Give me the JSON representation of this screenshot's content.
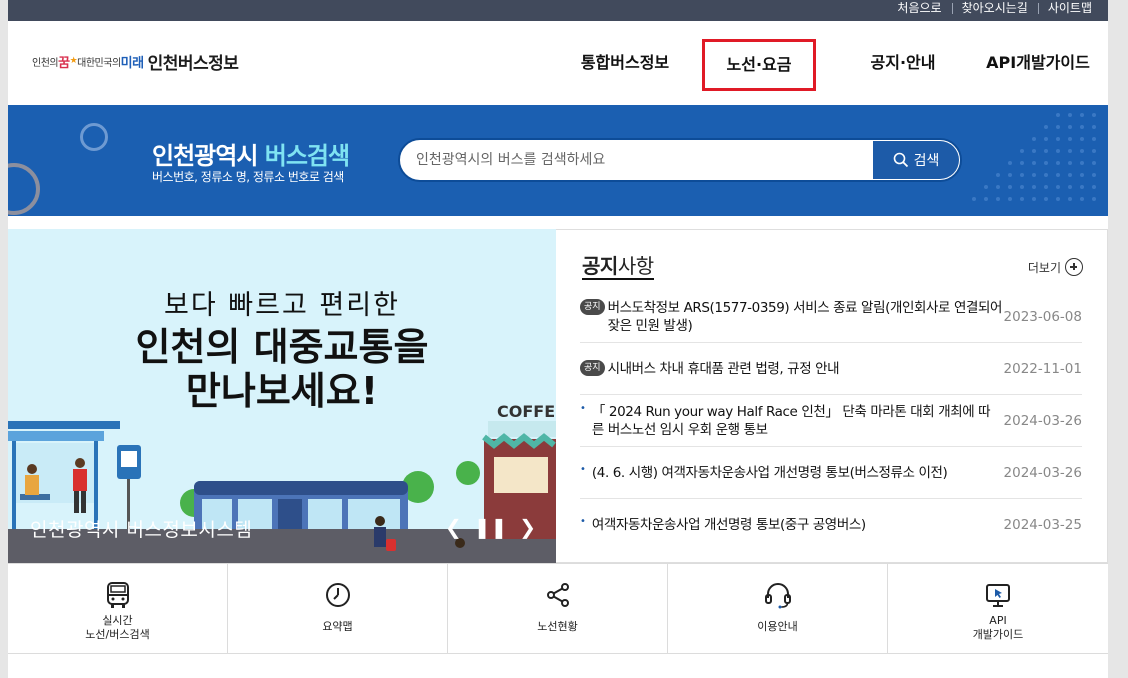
{
  "utility": [
    "처음으로",
    "찾아오시는길",
    "사이트맵"
  ],
  "logo": {
    "part1": "인천의",
    "part2": "꿈",
    "part3": "대한민국의",
    "part4": "미래",
    "name": "인천버스정보"
  },
  "gnb": [
    "통합버스정보",
    "노선·요금",
    "공지·안내",
    "API개발가이드"
  ],
  "banner": {
    "title_a": "인천광역시",
    "title_b": "버스검색",
    "sub": "버스번호, 정류소 명, 정류소 번호로 검색",
    "placeholder": "인천광역시의 버스를 검색하세요",
    "button": "검색"
  },
  "visual": {
    "line1": "보다 빠르고 편리한",
    "line2": "인천의 대중교통을",
    "line3": "만나보세요!",
    "caption": "인천광역시 버스정보시스템",
    "cafe": "COFFE"
  },
  "notice": {
    "title_bold": "공지",
    "title_rest": "사항",
    "more": "더보기",
    "tag": "공지",
    "items": [
      {
        "text": "버스도착정보 ARS(1577-0359) 서비스 종료 알림(개인회사로 연결되어 잦은 민원 발생)",
        "date": "2023-06-08"
      },
      {
        "text": "시내버스 차내 휴대품 관련 법령, 규정 안내",
        "date": "2022-11-01"
      },
      {
        "text": "「 2024 Run your way Half Race 인천」 단축 마라톤 대회 개최에 따른 버스노선 임시 우회 운행 통보",
        "date": "2024-03-26"
      },
      {
        "text": "(4. 6. 시행) 여객자동차운송사업 개선명령 통보(버스정류소 이전)",
        "date": "2024-03-26"
      },
      {
        "text": "여객자동차운송사업 개선명령 통보(중구 공영버스)",
        "date": "2024-03-25"
      }
    ]
  },
  "quick": [
    {
      "l1": "실시간",
      "l2": "노선/버스검색",
      "icon": "bus-icon"
    },
    {
      "l1": "요약맵",
      "icon": "clock-icon"
    },
    {
      "l1": "노선현황",
      "icon": "share-icon"
    },
    {
      "l1": "이용안내",
      "icon": "headset-icon"
    },
    {
      "l1": "API",
      "l2": "개발가이드",
      "icon": "monitor-icon"
    }
  ]
}
